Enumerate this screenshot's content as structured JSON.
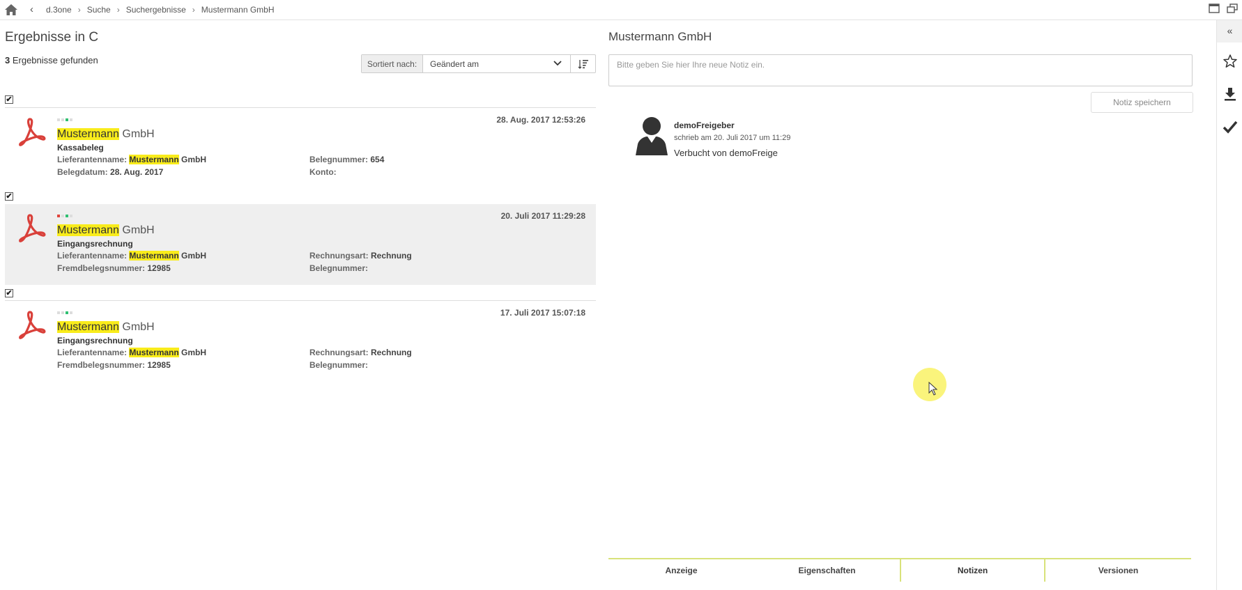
{
  "breadcrumb": {
    "back_label": "‹",
    "items": [
      "d.3one",
      "Suche",
      "Suchergebnisse",
      "Mustermann GmbH"
    ]
  },
  "left": {
    "title": "Ergebnisse in C",
    "count_number": "3",
    "count_text": " Ergebnisse gefunden",
    "sort_label": "Sortiert nach:",
    "sort_value": "Geändert am"
  },
  "results": [
    {
      "date": "28. Aug. 2017 12:53:26",
      "title_highlight": "Mustermann",
      "title_rest": " GmbH",
      "type": "Kassabeleg",
      "status_colors": [
        "#dddddd",
        "#dddddd",
        "#2fbf71",
        "#dddddd"
      ],
      "f1_label": "Lieferantenname: ",
      "f1_hl": "Mustermann",
      "f1_rest": " GmbH",
      "f2_label": "Belegnummer: ",
      "f2_value": "654",
      "f3_label": "Belegdatum: ",
      "f3_value": "28. Aug. 2017",
      "f4_label": "Konto: ",
      "f4_value": ""
    },
    {
      "date": "20. Juli 2017 11:29:28",
      "title_highlight": "Mustermann",
      "title_rest": " GmbH",
      "type": "Eingangsrechnung",
      "status_colors": [
        "#e0443c",
        "#dddddd",
        "#2fbf71",
        "#dddddd"
      ],
      "f1_label": "Lieferantenname: ",
      "f1_hl": "Mustermann",
      "f1_rest": " GmbH",
      "f2_label": "Rechnungsart: ",
      "f2_value": "Rechnung",
      "f3_label": "Fremdbelegsnummer: ",
      "f3_value": "12985",
      "f4_label": "Belegnummer: ",
      "f4_value": ""
    },
    {
      "date": "17. Juli 2017 15:07:18",
      "title_highlight": "Mustermann",
      "title_rest": " GmbH",
      "type": "Eingangsrechnung",
      "status_colors": [
        "#dddddd",
        "#dddddd",
        "#2fbf71",
        "#dddddd"
      ],
      "f1_label": "Lieferantenname: ",
      "f1_hl": "Mustermann",
      "f1_rest": " GmbH",
      "f2_label": "Rechnungsart: ",
      "f2_value": "Rechnung",
      "f3_label": "Fremdbelegsnummer: ",
      "f3_value": "12985",
      "f4_label": "Belegnummer: ",
      "f4_value": ""
    }
  ],
  "detail": {
    "title": "Mustermann GmbH",
    "note_placeholder": "Bitte geben Sie hier Ihre neue Notiz ein.",
    "save_label": "Notiz speichern",
    "note": {
      "author": "demoFreigeber",
      "meta": "schrieb am 20. Juli 2017 um 11:29",
      "text": "Verbucht von demoFreige"
    },
    "tabs": [
      "Anzeige",
      "Eigenschaften",
      "Notizen",
      "Versionen"
    ],
    "active_tab": "Notizen"
  },
  "rail": {
    "collapse_label": "«",
    "icons": [
      "star-icon",
      "download-icon",
      "checkmark-icon"
    ]
  },
  "colors": {
    "highlight": "#f9ec1b",
    "pdf_red": "#d9403a",
    "tab_accent": "#d8e27a",
    "selected_row": "#efefef"
  }
}
